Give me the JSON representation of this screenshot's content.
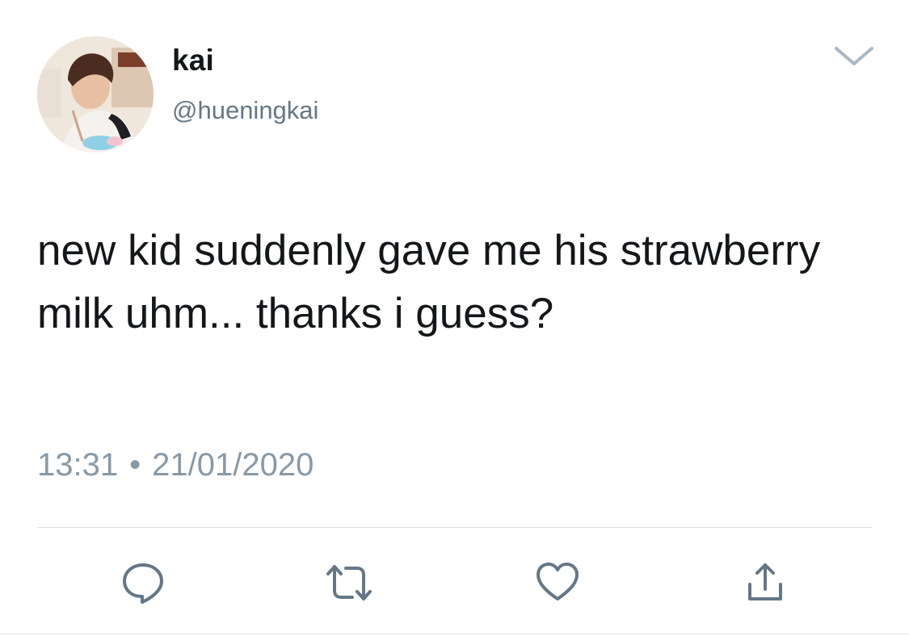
{
  "tweet": {
    "author": {
      "display_name": "kai",
      "handle": "@hueningkai",
      "avatar_icon": "profile-photo"
    },
    "text": "new kid suddenly gave me his strawberry milk uhm... thanks i guess?",
    "time": "13:31",
    "separator": "•",
    "date": "21/01/2020"
  },
  "actions": {
    "reply": "reply-icon",
    "retweet": "retweet-icon",
    "like": "heart-icon",
    "share": "share-icon"
  },
  "colors": {
    "text_primary": "#14171a",
    "text_secondary": "#657786",
    "meta_text": "#8899a6",
    "icon": "#657786",
    "divider": "#dbe1e6"
  }
}
